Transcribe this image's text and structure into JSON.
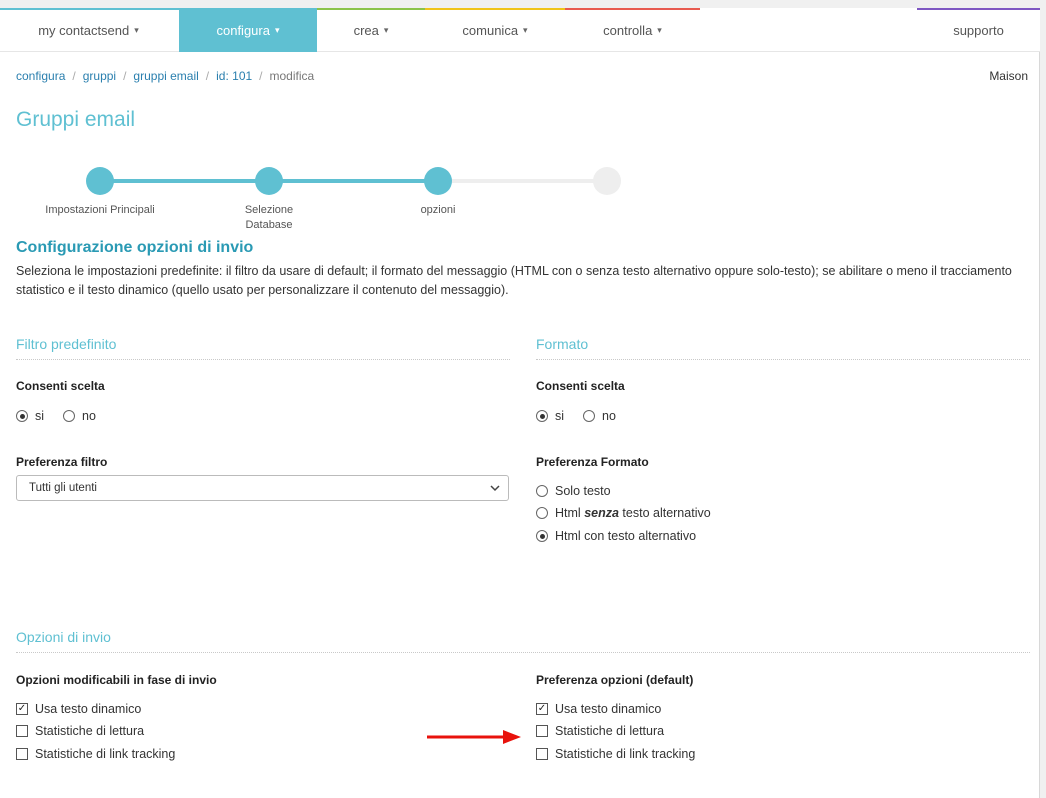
{
  "nav": {
    "items": [
      {
        "label": "my contactsend"
      },
      {
        "label": "configura"
      },
      {
        "label": "crea"
      },
      {
        "label": "comunica"
      },
      {
        "label": "controlla"
      }
    ],
    "support": "supporto",
    "colors": [
      "#5fc0d2",
      "#8bc34a",
      "#f0c419",
      "#e85a4f",
      "#7e57c2"
    ]
  },
  "breadcrumb": {
    "items": [
      "configura",
      "gruppi",
      "gruppi email",
      "id: 101"
    ],
    "current": "modifica"
  },
  "user": "Maison",
  "page_title": "Gruppi email",
  "stepper": {
    "steps": [
      "Impostazioni Principali",
      "Selezione Database",
      "opzioni",
      ""
    ],
    "completed_steps": 3,
    "accent": "#5fc0d2"
  },
  "intro": {
    "title": "Configurazione opzioni di invio",
    "description": "Seleziona le impostazioni predefinite: il filtro da usare di default; il formato del messaggio (HTML con o senza testo alternativo oppure solo-testo); se abilitare o meno il tracciamento statistico e il testo dinamico (quello usato per personalizzare il contenuto del messaggio)."
  },
  "filtro": {
    "heading": "Filtro predefinito",
    "consenti_label": "Consenti scelta",
    "si": "si",
    "no": "no",
    "selected": "si",
    "preferenza_label": "Preferenza filtro",
    "select_value": "Tutti gli utenti"
  },
  "formato": {
    "heading": "Formato",
    "consenti_label": "Consenti scelta",
    "si": "si",
    "no": "no",
    "selected": "si",
    "preferenza_label": "Preferenza Formato",
    "options": {
      "solo_testo": "Solo testo",
      "html_prefix": "Html",
      "html_senza": "senza",
      "html_suffix": "testo alternativo",
      "html_con": "Html con testo alternativo"
    },
    "selected_option": "Html con testo alternativo"
  },
  "opzioni": {
    "heading": "Opzioni di invio",
    "left_label": "Opzioni modificabili in fase di invio",
    "right_label": "Preferenza opzioni (default)",
    "items": [
      "Usa testo dinamico",
      "Statistiche di lettura",
      "Statistiche di link tracking"
    ],
    "left_checked": [
      true,
      false,
      false
    ],
    "right_checked": [
      true,
      false,
      false
    ]
  },
  "annotation_arrow_color": "#e8120c"
}
